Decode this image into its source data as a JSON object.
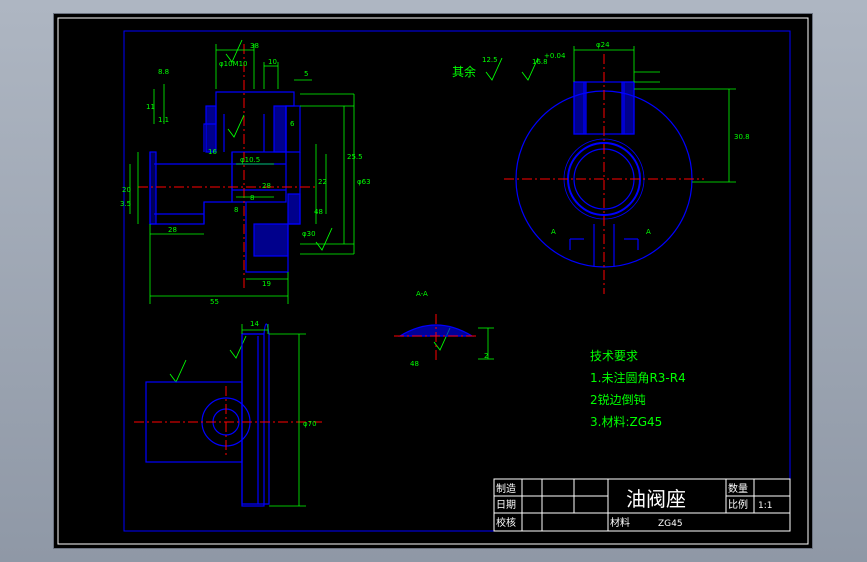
{
  "colors": {
    "background": "#000000",
    "outline": "#0000ff",
    "dimension": "#00ff00",
    "centerline": "#ff0000",
    "section_fill": "#0000ff",
    "title_text": "#ffffff",
    "note_text": "#00ff00"
  },
  "views": {
    "front": {
      "dims": {
        "d38": "38",
        "d10": "10",
        "d16": "16",
        "d5": "5",
        "d8_8": "8.8",
        "d28": "28",
        "d11": "11",
        "d1_1": "1.1",
        "d20": "20",
        "d3_5": "3.5",
        "d8": "8",
        "d55": "55",
        "d19": "19",
        "d6": "6",
        "d25_5": "25.5",
        "d63": "φ63",
        "d10_5": "φ10.5",
        "dm10": "φ10M10",
        "d22": "22",
        "d28b": "28",
        "d8b": "8",
        "d48": "48",
        "d30": "φ30"
      }
    },
    "side": {
      "label_qiyu": "其余",
      "roughness": "12.5",
      "roughness2": "16.8",
      "d24": "φ24",
      "d30_8": "30.8",
      "section_a": "A",
      "tol": "+0.04"
    },
    "section_aa": {
      "label": "A-A",
      "d2": "2",
      "d48": "48"
    },
    "bottom": {
      "d14": "14",
      "d70": "φ70"
    }
  },
  "notes": {
    "title": "技术要求",
    "line1": "1.未注圆角R3-R4",
    "line2": "2锐边倒钝",
    "line3": "3.材料:ZG45"
  },
  "title_block": {
    "draw": "制造",
    "date": "日期",
    "check": "校核",
    "part_name": "油阀座",
    "qty": "数量",
    "scale": "比例",
    "scale_val": "1:1",
    "material_label": "材料",
    "material_val": "ZG45"
  }
}
